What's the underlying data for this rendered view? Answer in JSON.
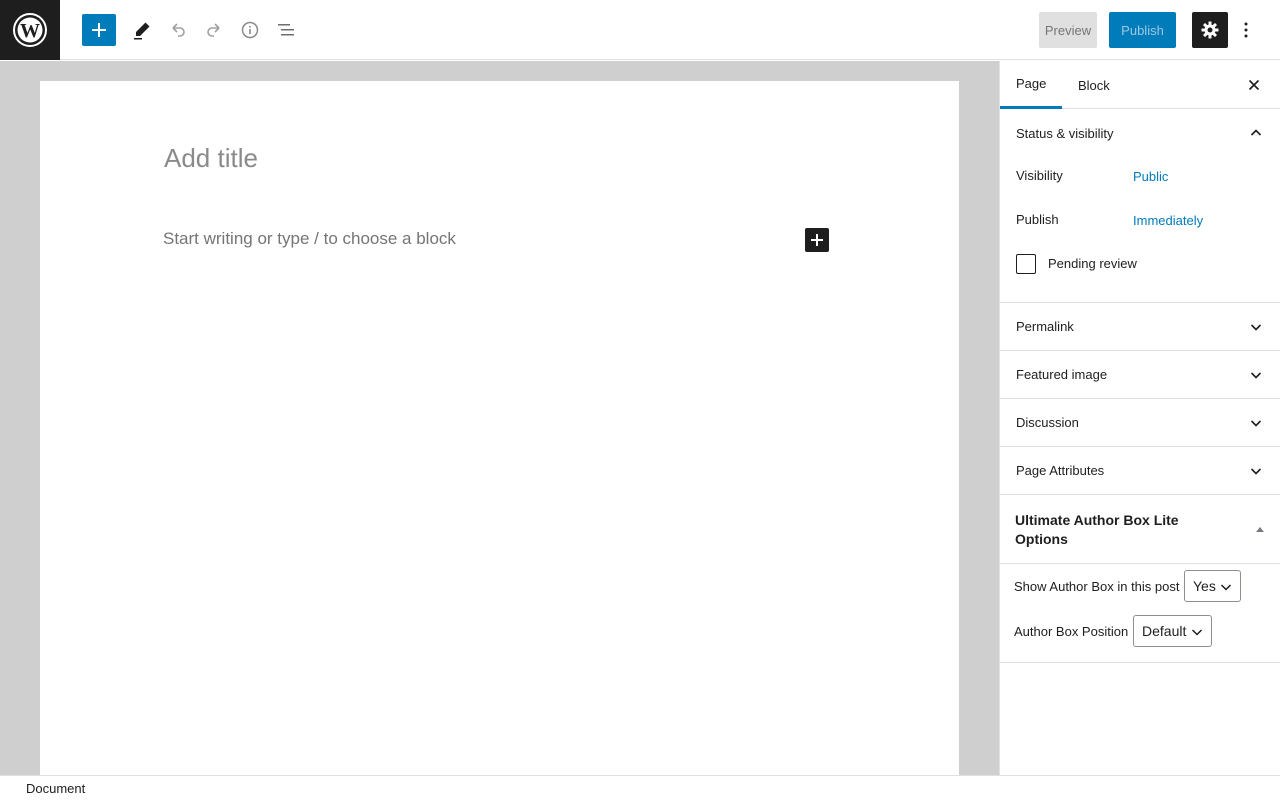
{
  "toolbar": {
    "logo": "wordpress-logo",
    "inserter_icon": "plus-icon",
    "tools_icon": "pencil-icon",
    "undo_icon": "undo-icon",
    "redo_icon": "redo-icon",
    "details_icon": "info-icon",
    "outline_icon": "list-view-icon",
    "preview_label": "Preview",
    "publish_label": "Publish",
    "settings_icon": "gear-icon",
    "more_icon": "more-vertical-icon"
  },
  "editor": {
    "title_placeholder": "Add title",
    "block_placeholder": "Start writing or type / to choose a block"
  },
  "sidebar": {
    "tabs": [
      {
        "label": "Page",
        "active": true
      },
      {
        "label": "Block",
        "active": false
      }
    ],
    "status": {
      "title": "Status & visibility",
      "visibility_label": "Visibility",
      "visibility_value": "Public",
      "publish_label": "Publish",
      "publish_value": "Immediately",
      "pending_label": "Pending review"
    },
    "panels": [
      "Permalink",
      "Featured image",
      "Discussion",
      "Page Attributes"
    ],
    "author_box": {
      "title": "Ultimate Author Box Lite Options",
      "show_label": "Show Author Box in this post",
      "show_value": "Yes",
      "position_label": "Author Box Position",
      "position_value": "Default"
    }
  },
  "footer": {
    "breadcrumb": "Document"
  },
  "colors": {
    "accent": "#007cba",
    "dark": "#1e1e1e",
    "canvas_bg": "#cfcfcf"
  }
}
